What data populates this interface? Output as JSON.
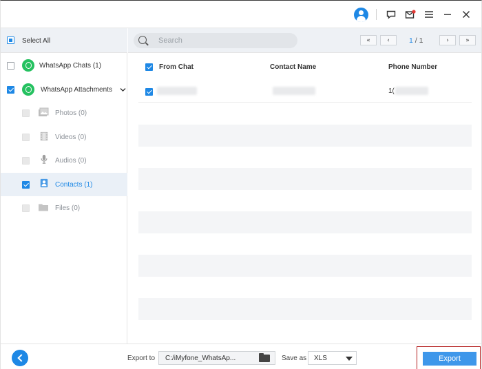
{
  "titlebar": {
    "icons": [
      "account-icon",
      "feedback-icon",
      "mail-icon",
      "menu-icon",
      "minimize-icon",
      "close-icon"
    ]
  },
  "sidebar": {
    "select_all": "Select All",
    "items": [
      {
        "label": "WhatsApp Chats (1)",
        "icon": "whatsapp-icon"
      },
      {
        "label": "WhatsApp Attachments",
        "icon": "whatsapp-icon"
      },
      {
        "label": "Photos (0)",
        "icon": "photos-icon"
      },
      {
        "label": "Videos (0)",
        "icon": "videos-icon"
      },
      {
        "label": "Audios (0)",
        "icon": "audios-icon"
      },
      {
        "label": "Contacts (1)",
        "icon": "contacts-icon"
      },
      {
        "label": "Files (0)",
        "icon": "files-icon"
      }
    ]
  },
  "toolbar": {
    "search_placeholder": "Search",
    "first_page": "«",
    "prev_page": "‹",
    "page_current": "1",
    "page_sep": " / ",
    "page_total": "1",
    "next_page": "›",
    "last_page": "»"
  },
  "table": {
    "columns": [
      "From Chat",
      "Contact Name",
      "Phone Number"
    ],
    "rows": [
      {
        "from_chat": "",
        "contact_name": "",
        "phone_prefix": "1("
      }
    ]
  },
  "footer": {
    "export_to_label": "Export to",
    "export_path": "C:/iMyfone_WhatsAp...",
    "save_as_label": "Save as",
    "format": "XLS",
    "export_button": "Export"
  },
  "colors": {
    "accent": "#1e88e5",
    "whatsapp": "#25c160",
    "highlight": "#b31b1b"
  }
}
